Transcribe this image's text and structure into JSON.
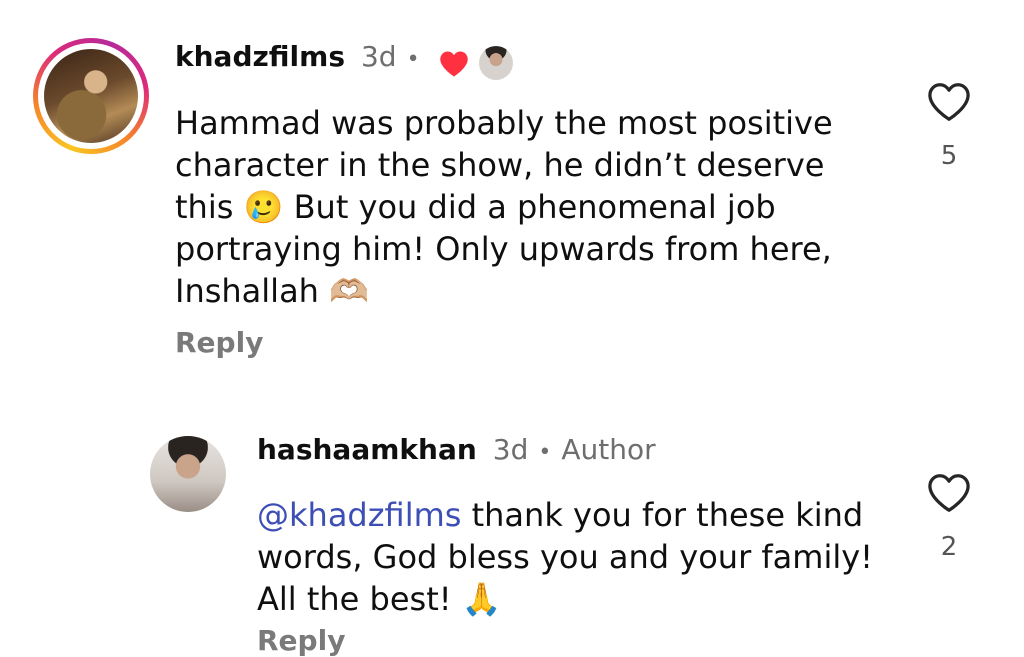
{
  "comments": [
    {
      "username": "khadzfilms",
      "time": "3d",
      "separator": "•",
      "text": "Hammad was probably the most positive character in the show, he didn’t deserve this 🥲 But you did a phenomenal job portraying him! Only upwards from here, Inshallah 🫶🏼",
      "reply_label": "Reply",
      "like_count": "5",
      "liked_by_creator": true,
      "colors": {
        "heart": "#ff3040",
        "ring_gradient": [
          "#f9c623",
          "#f58529",
          "#dd2a7b"
        ]
      }
    },
    {
      "username": "hashaamkhan",
      "time": "3d",
      "separator": "•",
      "badge": "Author",
      "mention": "@khadzfilms",
      "text": " thank you for these kind words, God bless you and your family! All the best! 🙏",
      "reply_label": "Reply",
      "like_count": "2",
      "colors": {
        "mention": "#3d4fb5"
      }
    }
  ],
  "icons": {
    "like": "heart-outline-icon",
    "liked_by_creator": "heart-filled-icon"
  }
}
